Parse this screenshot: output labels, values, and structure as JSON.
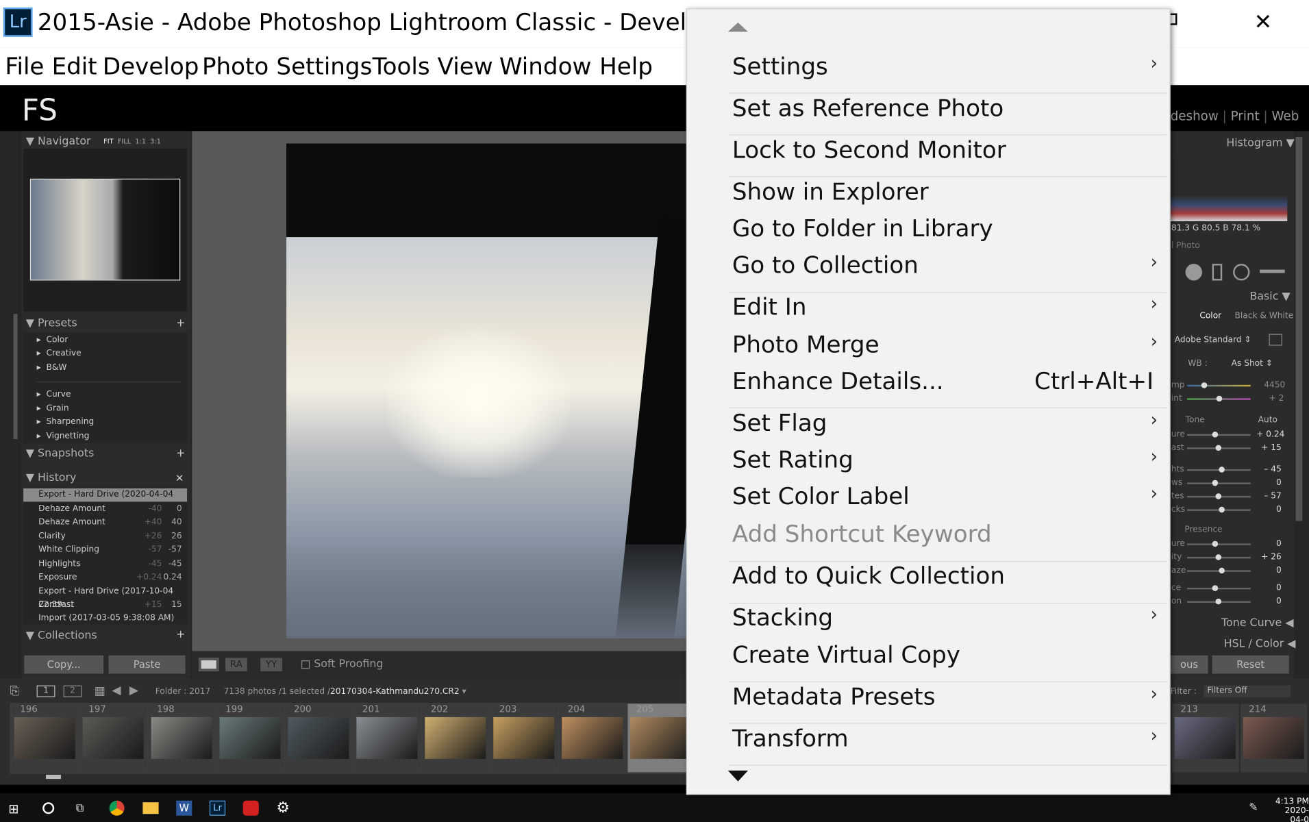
{
  "window": {
    "title": "2015-Asie - Adobe Photoshop Lightroom Classic - Develop",
    "app_icon": "Lr"
  },
  "menubar": [
    "File",
    "Edit",
    "Develop",
    "Photo",
    "Settings",
    "Tools",
    "View",
    "Window",
    "Help"
  ],
  "identity": {
    "plate": "FS",
    "modules_visible": [
      "deshow",
      "Print",
      "Web"
    ]
  },
  "left_panel": {
    "navigator": {
      "title": "Navigator",
      "zoom": [
        "FIT",
        "FILL",
        "1:1",
        "3:1"
      ]
    },
    "presets": {
      "title": "Presets",
      "items": [
        "Color",
        "Creative",
        "B&W",
        "Curve",
        "Grain",
        "Sharpening",
        "Vignetting"
      ]
    },
    "snapshots": {
      "title": "Snapshots"
    },
    "history": {
      "title": "History",
      "items": [
        {
          "label": "Export - Hard Drive (2020-04-04 3:54:3...",
          "a": "",
          "b": ""
        },
        {
          "label": "Dehaze Amount",
          "a": "-40",
          "b": "0"
        },
        {
          "label": "Dehaze Amount",
          "a": "+40",
          "b": "40"
        },
        {
          "label": "Clarity",
          "a": "+26",
          "b": "26"
        },
        {
          "label": "White Clipping",
          "a": "-57",
          "b": "-57"
        },
        {
          "label": "Highlights",
          "a": "-45",
          "b": "-45"
        },
        {
          "label": "Exposure",
          "a": "+0.24",
          "b": "0.24"
        },
        {
          "label": "Export - Hard Drive (2017-10-04 22:59:...",
          "a": "",
          "b": ""
        },
        {
          "label": "Contrast",
          "a": "+15",
          "b": "15"
        },
        {
          "label": "Import (2017-03-05 9:38:08 AM)",
          "a": "",
          "b": ""
        }
      ]
    },
    "collections": {
      "title": "Collections"
    },
    "copy_label": "Copy...",
    "paste_label": "Paste"
  },
  "toolbar": {
    "soft_proofing": "Soft Proofing"
  },
  "right_panel": {
    "histogram": "Histogram",
    "rgb": "81.3  G  80.5  B  78.1  %",
    "photo_label": "l Photo",
    "basic": "Basic",
    "color": "Color",
    "bw": "Black & White",
    "profile": "Adobe Standard",
    "wb_label": "WB :",
    "wb_value": "As Shot",
    "temp_label": "mp",
    "temp_val": "4450",
    "tint_label": "int",
    "tint_val": "+ 2",
    "tone": "Tone",
    "auto": "Auto",
    "tone_rows": [
      {
        "l": "ure",
        "v": "+ 0.24"
      },
      {
        "l": "ast",
        "v": "+ 15"
      },
      {
        "l": "hts",
        "v": "– 45"
      },
      {
        "l": "ws",
        "v": "0"
      },
      {
        "l": "tes",
        "v": "– 57"
      },
      {
        "l": "cks",
        "v": "0"
      }
    ],
    "presence": "Presence",
    "presence_rows": [
      {
        "l": "ure",
        "v": "0"
      },
      {
        "l": "ity",
        "v": "+ 26"
      },
      {
        "l": "aze",
        "v": "0"
      },
      {
        "l": "ce",
        "v": "0"
      },
      {
        "l": "on",
        "v": "0"
      }
    ],
    "tone_curve": "Tone Curve",
    "hsl": "HSL / Color",
    "prev": "ous",
    "reset": "Reset"
  },
  "filmstrip": {
    "folder": "Folder : 2017",
    "count": "7138 photos /1 selected /",
    "file": "20170304-Kathmandu270.CR2",
    "filter_label": "Filter :",
    "filter_value": "Filters Off",
    "numbers": [
      "196",
      "197",
      "198",
      "199",
      "200",
      "201",
      "202",
      "203",
      "204",
      "205",
      "213",
      "214"
    ]
  },
  "context_menu": {
    "items": [
      {
        "label": "Settings",
        "submenu": true
      },
      {
        "label": "Set as Reference Photo"
      },
      {
        "label": "Lock to Second Monitor"
      },
      {
        "label": "Show in Explorer"
      },
      {
        "label": "Go to Folder in Library"
      },
      {
        "label": "Go to Collection",
        "submenu": true
      },
      {
        "label": "Edit In",
        "submenu": true
      },
      {
        "label": "Photo Merge",
        "submenu": true
      },
      {
        "label": "Enhance Details...",
        "shortcut": "Ctrl+Alt+I"
      },
      {
        "label": "Set Flag",
        "submenu": true
      },
      {
        "label": "Set Rating",
        "submenu": true
      },
      {
        "label": "Set Color Label",
        "submenu": true
      },
      {
        "label": "Add Shortcut Keyword",
        "disabled": true
      },
      {
        "label": "Add to Quick Collection"
      },
      {
        "label": "Stacking",
        "submenu": true
      },
      {
        "label": "Create Virtual Copy"
      },
      {
        "label": "Metadata Presets",
        "submenu": true
      },
      {
        "label": "Transform",
        "submenu": true
      }
    ]
  },
  "taskbar": {
    "time": "4:13 PM",
    "date": "2020-04-0"
  }
}
